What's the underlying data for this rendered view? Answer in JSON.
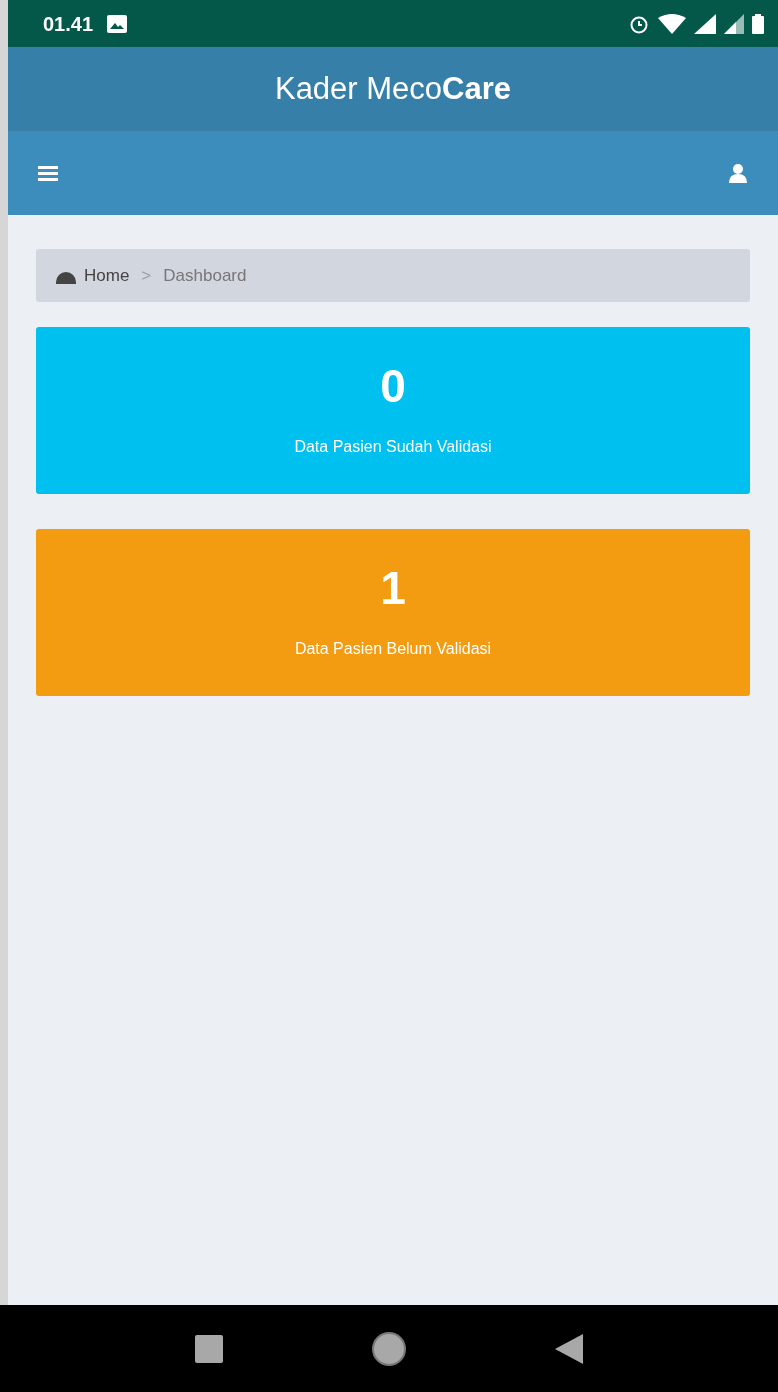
{
  "status_bar": {
    "time": "01.41"
  },
  "app_title": "Kader Meco**Care**",
  "breadcrumb_separator": ">",
  "breadcrumb": [
    {
      "label": "Home",
      "kind": "link"
    },
    {
      "label": "Dashboard",
      "kind": "current"
    }
  ],
  "cards": [
    {
      "count": "0",
      "label": "Data Pasien Sudah Validasi",
      "color": "#00c0ef"
    },
    {
      "count": "1",
      "label": "Data Pasien Belum Validasi",
      "color": "#f39c12"
    }
  ]
}
